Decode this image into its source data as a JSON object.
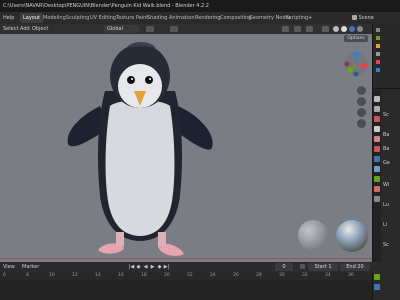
{
  "window": {
    "title": "C:\\Users\\NAVAR\\Desktop\\PENGUIN\\Blender\\Penguin Kid Walk.blend - Blender 4.2.2",
    "scene_label": "Scene"
  },
  "menubar": {
    "items": [
      "Help"
    ],
    "workspaces": [
      "Layout",
      "Modeling",
      "Sculpting",
      "UV Editing",
      "Texture Paint",
      "Shading",
      "Animation",
      "Rendering",
      "Compositing",
      "Geometry Nodes",
      "Scripting"
    ],
    "add_tab": "+"
  },
  "viewport_header": {
    "menu": [
      "Select",
      "Add",
      "Object"
    ],
    "transform_orientation": "Global",
    "options_label": "Options"
  },
  "timeline": {
    "menu": [
      "View",
      "Marker"
    ],
    "current_frame": "0",
    "start_label": "Start",
    "start_value": "1",
    "end_label": "End",
    "end_value": "20",
    "ruler_ticks": [
      "6",
      "8",
      "10",
      "12",
      "14",
      "16",
      "18",
      "20",
      "22",
      "24",
      "26",
      "28",
      "30",
      "32",
      "34",
      "36"
    ]
  },
  "properties": {
    "labels": [
      "Sc",
      "Ba",
      "Ba",
      "Ge",
      "Wi",
      "Lu",
      "Li",
      "Sc"
    ]
  },
  "colors": {
    "viewport_bg": "#7a7d84",
    "accent_active": "#4772b3",
    "gizmo_x": "#e04552",
    "gizmo_y": "#6aa318",
    "gizmo_z": "#3a7cd4"
  }
}
